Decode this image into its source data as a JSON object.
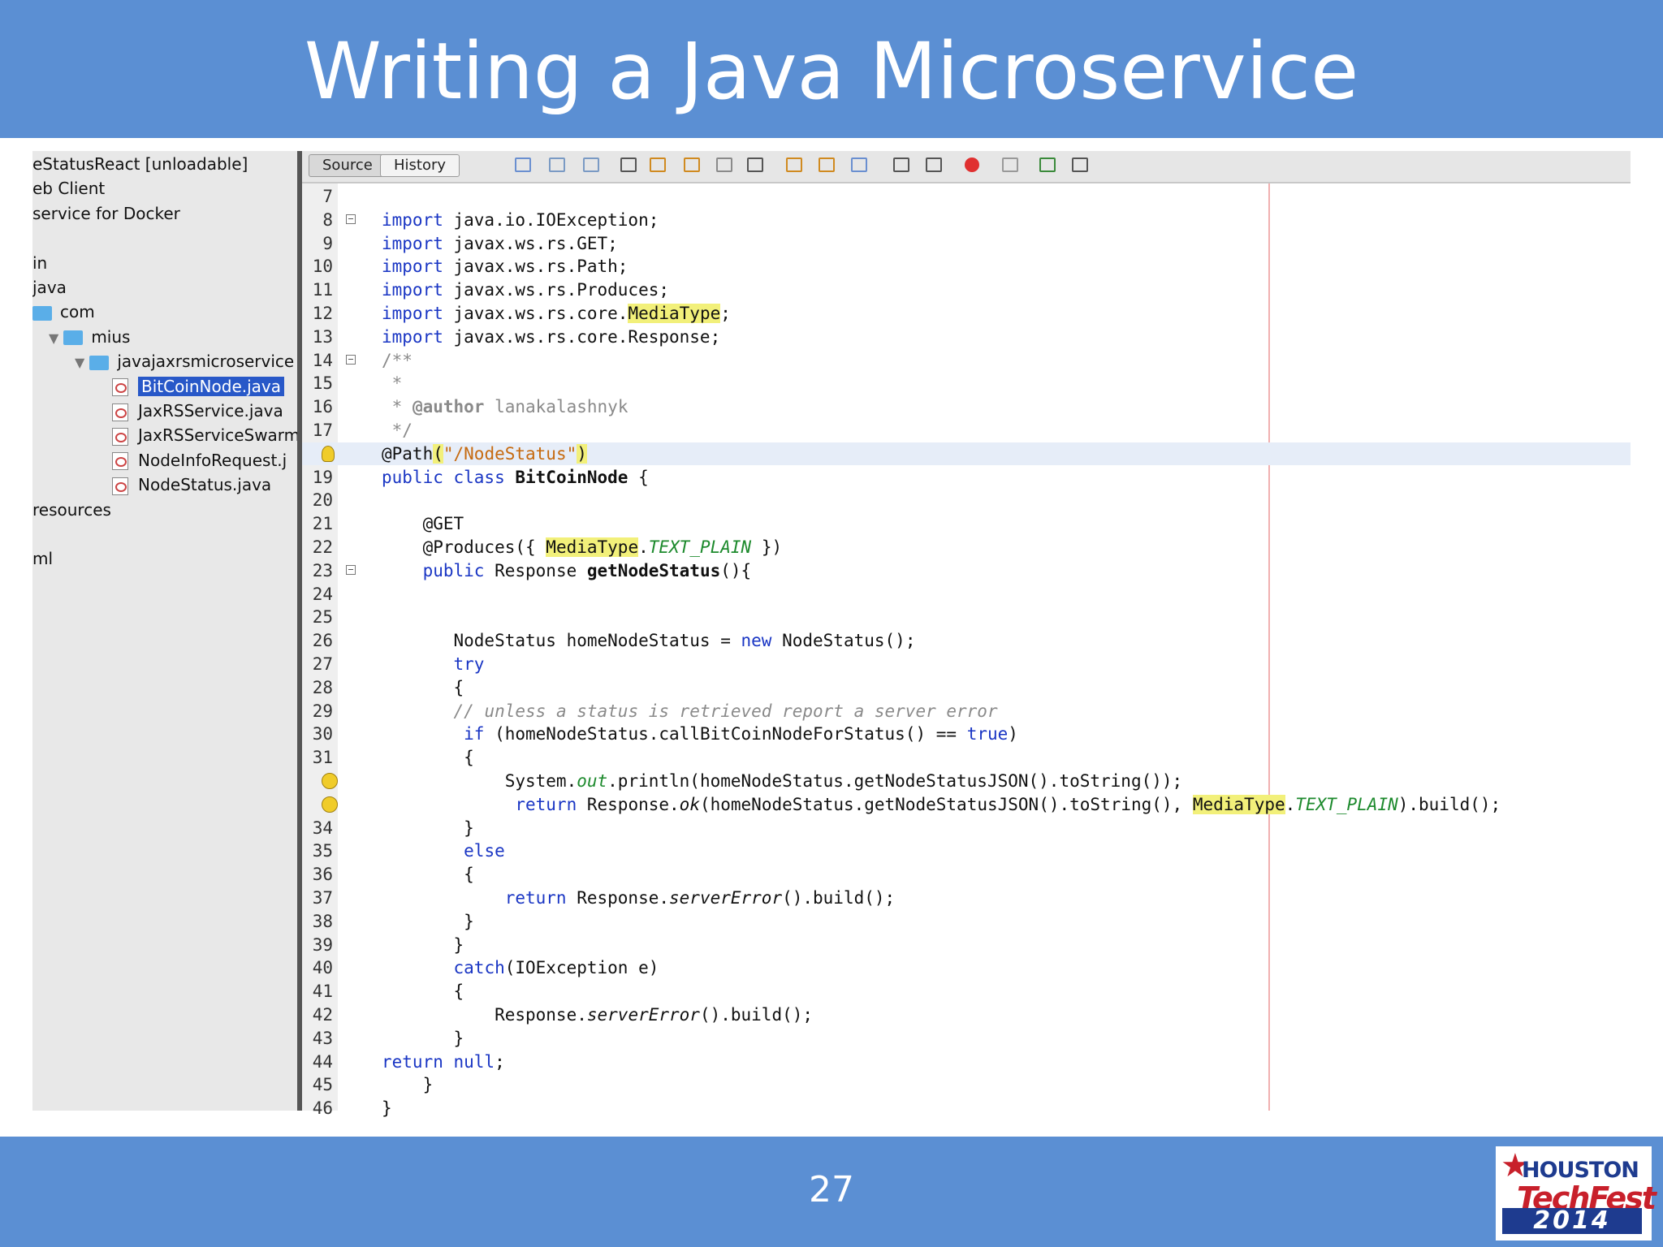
{
  "slide": {
    "title": "Writing a Java Microservice",
    "page_number": "27",
    "logo": {
      "line1": "HOUSTON",
      "line2": "TechFest",
      "line3": "2014"
    }
  },
  "project_tree": [
    {
      "label": "eStatusReact [unloadable]",
      "indent": 0,
      "kind": "text"
    },
    {
      "label": "eb Client",
      "indent": 0,
      "kind": "text"
    },
    {
      "label": "service for Docker",
      "indent": 0,
      "kind": "text"
    },
    {
      "label": "",
      "indent": 0,
      "kind": "text"
    },
    {
      "label": "in",
      "indent": 0,
      "kind": "text"
    },
    {
      "label": "java",
      "indent": 0,
      "kind": "text"
    },
    {
      "label": "com",
      "indent": 0,
      "kind": "folder"
    },
    {
      "label": "mius",
      "indent": 1,
      "kind": "folder-open"
    },
    {
      "label": "javajaxrsmicroservice",
      "indent": 2,
      "kind": "folder-open"
    },
    {
      "label": "BitCoinNode.java",
      "indent": 3,
      "kind": "file",
      "selected": true
    },
    {
      "label": "JaxRSService.java",
      "indent": 3,
      "kind": "file"
    },
    {
      "label": "JaxRSServiceSwarm",
      "indent": 3,
      "kind": "file"
    },
    {
      "label": "NodeInfoRequest.j",
      "indent": 3,
      "kind": "file"
    },
    {
      "label": "NodeStatus.java",
      "indent": 3,
      "kind": "file"
    },
    {
      "label": "resources",
      "indent": 0,
      "kind": "text"
    },
    {
      "label": "",
      "indent": 0,
      "kind": "text"
    },
    {
      "label": "ml",
      "indent": 0,
      "kind": "text"
    }
  ],
  "toolbar": {
    "source_label": "Source",
    "history_label": "History",
    "icons": [
      "last-edit-icon",
      "back-icon",
      "forward-icon",
      "find-icon",
      "find-prev-icon",
      "find-next-icon",
      "toggle-highlight-icon",
      "toggle-rect-select-icon",
      "prev-bookmark-icon",
      "next-bookmark-icon",
      "toggle-bookmark-icon",
      "shift-left-icon",
      "shift-right-icon",
      "start-macro-icon",
      "stop-macro-icon",
      "comment-icon",
      "uncomment-icon"
    ]
  },
  "code_lines": [
    {
      "n": "7",
      "html": ""
    },
    {
      "n": "8",
      "html": "<span class='kw'>import</span> java.io.IOException;",
      "fold": true
    },
    {
      "n": "9",
      "html": "<span class='kw'>import</span> javax.ws.rs.GET;"
    },
    {
      "n": "10",
      "html": "<span class='kw'>import</span> javax.ws.rs.Path;"
    },
    {
      "n": "11",
      "html": "<span class='kw'>import</span> javax.ws.rs.Produces;"
    },
    {
      "n": "12",
      "html": "<span class='kw'>import</span> javax.ws.rs.core.<span class='hl'>MediaType</span>;"
    },
    {
      "n": "13",
      "html": "<span class='kw'>import</span> javax.ws.rs.core.Response;"
    },
    {
      "n": "14",
      "html": "<span class='cm'>/**</span>",
      "fold": true
    },
    {
      "n": "15",
      "html": "<span class='cm'> *</span>"
    },
    {
      "n": "16",
      "html": "<span class='cm'> * <b>@author</b> lanakalashnyk</span>"
    },
    {
      "n": "17",
      "html": "<span class='cm'> */</span>"
    },
    {
      "n": "",
      "html": "@Path<span class='hl'>(</span><span class='str'>\"/NodeStatus\"</span><span class='hl'>)</span>",
      "current": true,
      "bulb": true
    },
    {
      "n": "19",
      "html": "<span class='kw'>public class</span> <span class='bold'>BitCoinNode</span> {"
    },
    {
      "n": "20",
      "html": ""
    },
    {
      "n": "21",
      "html": "    @GET"
    },
    {
      "n": "22",
      "html": "    @Produces({ <span class='hl'>MediaType</span>.<span class='fld'>TEXT_PLAIN</span> })"
    },
    {
      "n": "23",
      "html": "    <span class='kw'>public</span> Response <span class='bold'>getNodeStatus</span>(){",
      "fold": true
    },
    {
      "n": "24",
      "html": ""
    },
    {
      "n": "25",
      "html": ""
    },
    {
      "n": "26",
      "html": "       NodeStatus homeNodeStatus = <span class='kw'>new</span> NodeStatus();"
    },
    {
      "n": "27",
      "html": "       <span class='kw'>try</span>"
    },
    {
      "n": "28",
      "html": "       {"
    },
    {
      "n": "29",
      "html": "       <span class='cm it'>// unless a status is retrieved report a server error</span>"
    },
    {
      "n": "30",
      "html": "        <span class='kw'>if</span> (homeNodeStatus.callBitCoinNodeForStatus() == <span class='kw'>true</span>)"
    },
    {
      "n": "31",
      "html": "        {"
    },
    {
      "n": "",
      "html": "            System.<span class='fld'>out</span>.println(homeNodeStatus.getNodeStatusJSON().toString());",
      "warn": true
    },
    {
      "n": "",
      "html": "             <span class='kw'>return</span> Response.<span class='it'>ok</span>(homeNodeStatus.getNodeStatusJSON().toString(), <span class='hl'>MediaType</span>.<span class='fld'>TEXT_PLAIN</span>).build();",
      "warn": true
    },
    {
      "n": "34",
      "html": "        }"
    },
    {
      "n": "35",
      "html": "        <span class='kw'>else</span>"
    },
    {
      "n": "36",
      "html": "        {"
    },
    {
      "n": "37",
      "html": "            <span class='kw'>return</span> Response.<span class='it'>serverError</span>().build();"
    },
    {
      "n": "38",
      "html": "        }"
    },
    {
      "n": "39",
      "html": "       }"
    },
    {
      "n": "40",
      "html": "       <span class='kw'>catch</span>(IOException e)"
    },
    {
      "n": "41",
      "html": "       {"
    },
    {
      "n": "42",
      "html": "           Response.<span class='it'>serverError</span>().build();"
    },
    {
      "n": "43",
      "html": "       }"
    },
    {
      "n": "44",
      "html": "<span class='kw'>return null</span>;"
    },
    {
      "n": "45",
      "html": "    }"
    },
    {
      "n": "46",
      "html": "}"
    }
  ]
}
